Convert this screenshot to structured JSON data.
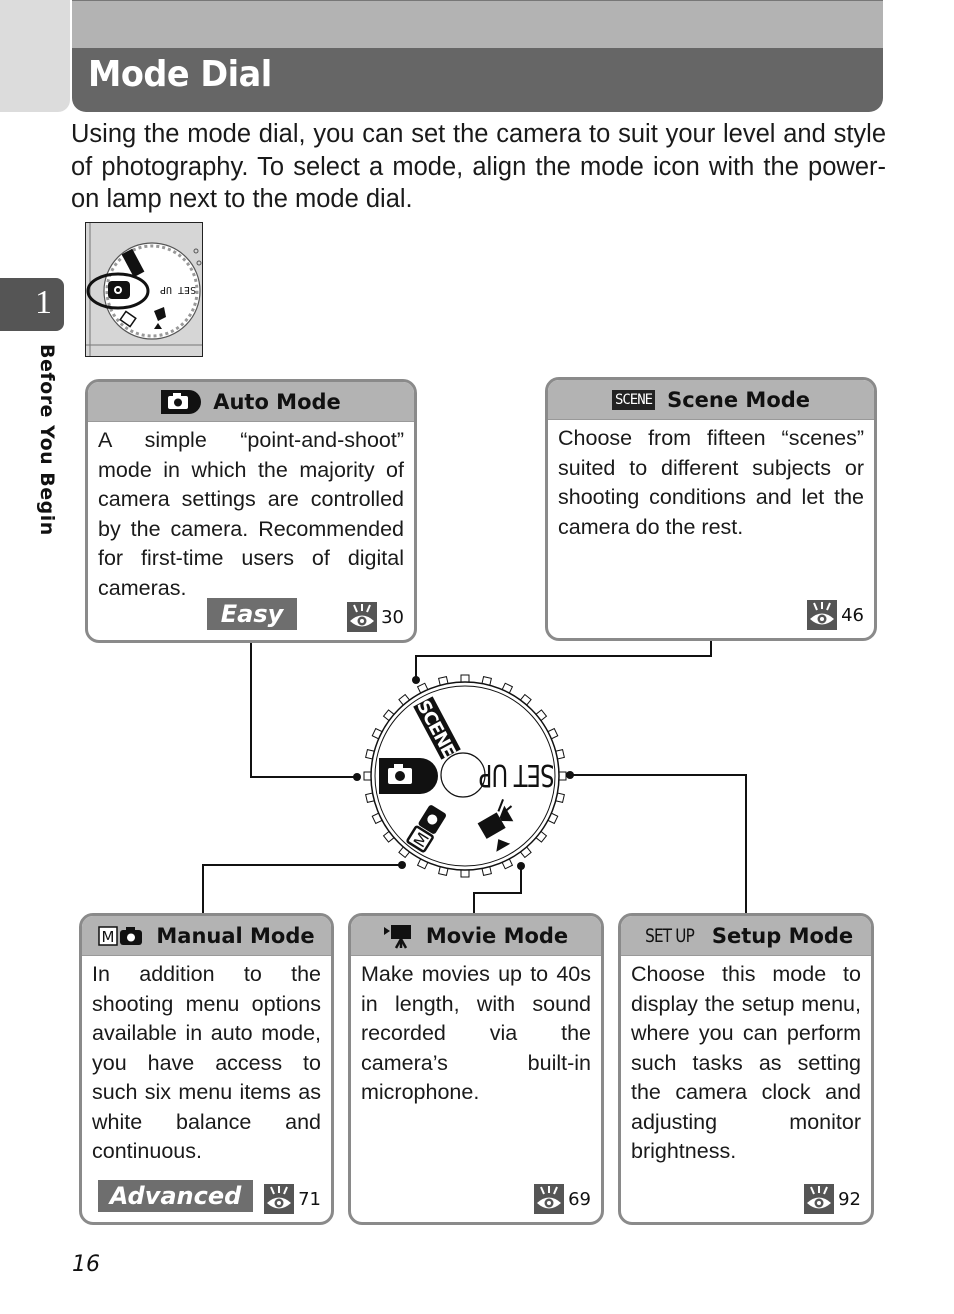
{
  "header": {
    "title": "Mode Dial"
  },
  "intro": "Using the mode dial, you can set the camera to suit your level and style of photography. To select a mode, align the mode icon with the power-on lamp next to the mode dial.",
  "chapter": {
    "number": "1",
    "label": "Before You Begin"
  },
  "thumbnail": {
    "dial_label": "SET UP",
    "scene_label": "SCENE"
  },
  "dial": {
    "scene_label": "SCENE",
    "setup_label": "SET UP",
    "manual_label": "M"
  },
  "modes": {
    "auto": {
      "icon": "camera-icon",
      "title": "Auto Mode",
      "body": "A simple “point-and-shoot” mode in which the majority of camera settings are controlled by the camera. Recommended for first-time users of digital cameras.",
      "level": "Easy",
      "page_ref": "30"
    },
    "scene": {
      "icon": "scene-icon",
      "icon_text": "SCENE",
      "title": "Scene Mode",
      "body": "Choose from fifteen “scenes” suited to different subjects or shooting conditions and let the camera do the rest.",
      "page_ref": "46"
    },
    "manual": {
      "icon": "manual-camera-icon",
      "icon_text": "M",
      "title": "Manual Mode",
      "body": "In addition to the shooting menu options available in auto mode, you have access to such six menu items as white balance and continuous.",
      "level": "Advanced",
      "page_ref": "71"
    },
    "movie": {
      "icon": "movie-camera-icon",
      "title": "Movie Mode",
      "body": "Make movies up to 40s in length, with sound recorded via the camera’s built-in microphone.",
      "page_ref": "69"
    },
    "setup": {
      "icon": "setup-icon",
      "icon_text": "SET UP",
      "title": "Setup Mode",
      "body": "Choose this mode to display the setup menu, where you can perform such tasks as setting the camera clock and adjusting monitor brightness.",
      "page_ref": "92"
    }
  },
  "page_number": "16"
}
